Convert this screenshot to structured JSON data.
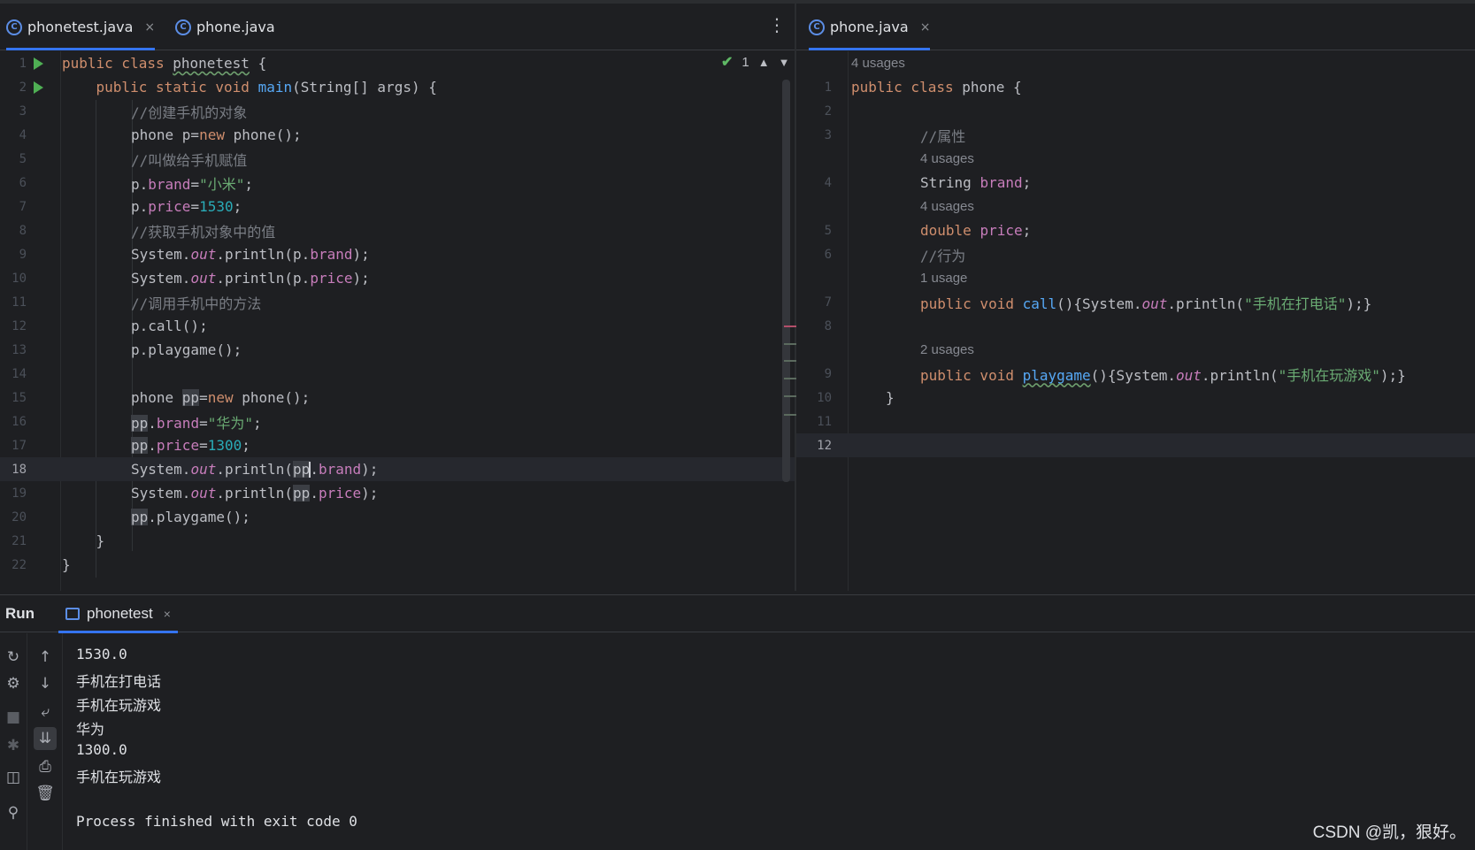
{
  "left_tabs": [
    {
      "label": "phonetest.java",
      "active": true,
      "closable": true
    },
    {
      "label": "phone.java",
      "active": false,
      "closable": false
    }
  ],
  "right_tabs": [
    {
      "label": "phone.java",
      "active": true,
      "closable": true
    }
  ],
  "tab_close_glyph": "×",
  "class_icon_letter": "C",
  "kebab_glyph": "⋮",
  "inspection": {
    "count": "1"
  },
  "left_editor": {
    "line_numbers": [
      "1",
      "2",
      "3",
      "4",
      "5",
      "6",
      "7",
      "8",
      "9",
      "10",
      "11",
      "12",
      "13",
      "14",
      "15",
      "16",
      "17",
      "18",
      "19",
      "20",
      "21",
      "22"
    ],
    "current_line": "18",
    "comments": [
      "//创建手机的对象",
      "//叫做给手机赋值",
      "//获取手机对象中的值",
      "//调用手机中的方法"
    ],
    "strings": [
      "\"小米\"",
      "\"华为\""
    ],
    "numbers": [
      "1530",
      "1300"
    ]
  },
  "right_editor": {
    "usages": [
      "4 usages",
      "4 usages",
      "4 usages",
      "1 usage",
      "2 usages"
    ],
    "line_numbers": [
      "1",
      "2",
      "3",
      "4",
      "5",
      "6",
      "7",
      "8",
      "9",
      "10",
      "11",
      "12"
    ],
    "current_line": "12",
    "comments": [
      "//属性",
      "//行为"
    ],
    "strings": [
      "\"手机在打电话\"",
      "\"手机在玩游戏\""
    ]
  },
  "run_panel": {
    "title": "Run",
    "tab_label": "phonetest",
    "output": [
      "1530.0",
      "手机在打电话",
      "手机在玩游戏",
      "华为",
      "1300.0",
      "手机在玩游戏",
      "",
      "Process finished with exit code 0"
    ]
  },
  "watermark": "CSDN @凯，狠好。",
  "colors": {
    "background": "#1e1f22",
    "keyword": "#cf8e6d",
    "function": "#56a8f5",
    "field": "#c77dbb",
    "string": "#6aab73",
    "number": "#2aacb8",
    "comment": "#7a7e85",
    "accent": "#3574f0"
  }
}
